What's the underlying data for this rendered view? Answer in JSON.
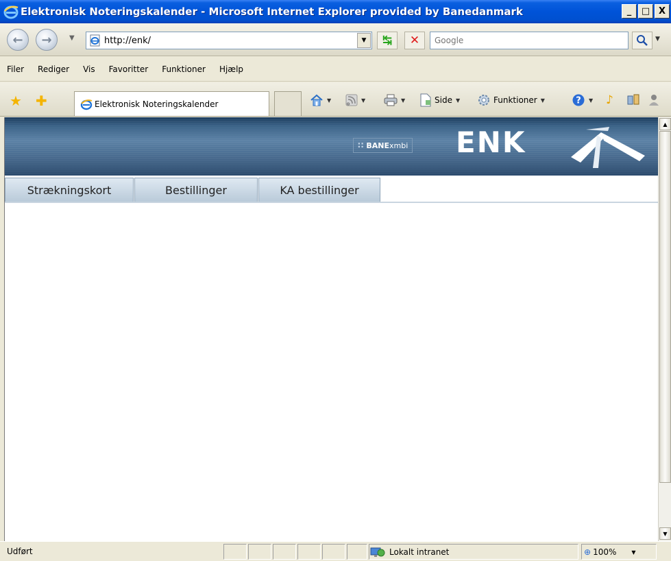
{
  "window": {
    "title": "Elektronisk Noteringskalender - Microsoft Internet Explorer provided by Banedanmark",
    "minimize_label": "_",
    "maximize_label": "□",
    "close_label": "X"
  },
  "addressbar": {
    "url": "http://enk/",
    "search_placeholder": "Google"
  },
  "menubar": {
    "items": [
      "Filer",
      "Rediger",
      "Vis",
      "Favoritter",
      "Funktioner",
      "Hjælp"
    ]
  },
  "favbar": {
    "tab_title": "Elektronisk Noteringskalender",
    "side_label": "Side",
    "funktioner_label": "Funktioner"
  },
  "page": {
    "bane_logo": "BANE",
    "bane_logo_suffix": "xmbi",
    "enk_logo": "ENK",
    "tabs": [
      "Strækningskort",
      "Bestillinger",
      "KA bestillinger"
    ]
  },
  "statusbar": {
    "status": "Udført",
    "zone": "Lokalt intranet",
    "zoom": "100%"
  },
  "colors": {
    "titlebar": "#0053d8",
    "banner": "#47698d",
    "tab_fill": "#c9d7e4"
  },
  "icons": [
    "ie-logo-icon",
    "back-arrow-icon",
    "forward-arrow-icon",
    "page-icon",
    "refresh-icon",
    "stop-icon",
    "search-icon",
    "favorites-star-icon",
    "add-favorite-icon",
    "home-icon",
    "feeds-icon",
    "print-icon",
    "page-menu-icon",
    "tools-gear-icon",
    "help-icon",
    "research-icon",
    "messenger-icon",
    "intranet-zone-icon",
    "zoom-icon"
  ]
}
